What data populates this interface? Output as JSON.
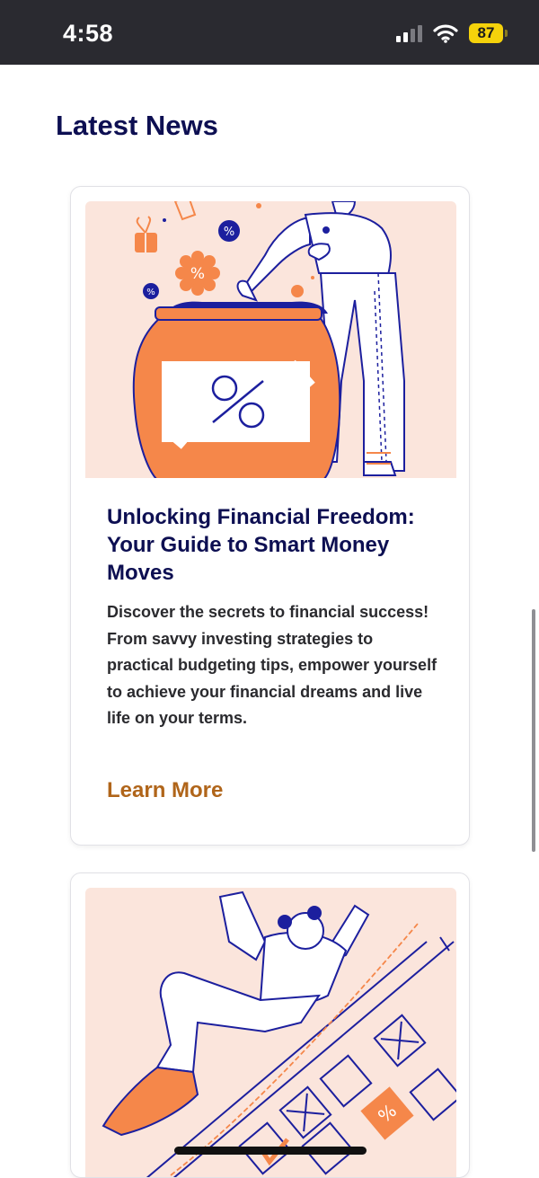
{
  "status_bar": {
    "time": "4:58",
    "battery": "87",
    "icons": [
      "signal-icon",
      "wifi-icon",
      "battery-icon"
    ]
  },
  "section": {
    "title": "Latest News"
  },
  "articles": [
    {
      "title": "Unlocking Financial Freedom: Your Guide to Smart Money Moves",
      "body": "Discover the secrets to financial success! From savvy investing strategies to practical budgeting tips, empower yourself to achieve your financial dreams and live life on your terms.",
      "link": "Learn More",
      "image": "person-with-percentage-jar-illustration"
    },
    {
      "image": "person-on-calculator-keypad-illustration"
    }
  ],
  "colors": {
    "heading": "#0d0f52",
    "link": "#b0651a",
    "illustration_bg": "#fbe5dc",
    "illustration_orange": "#f5874a",
    "illustration_navy": "#1c1f9e"
  }
}
